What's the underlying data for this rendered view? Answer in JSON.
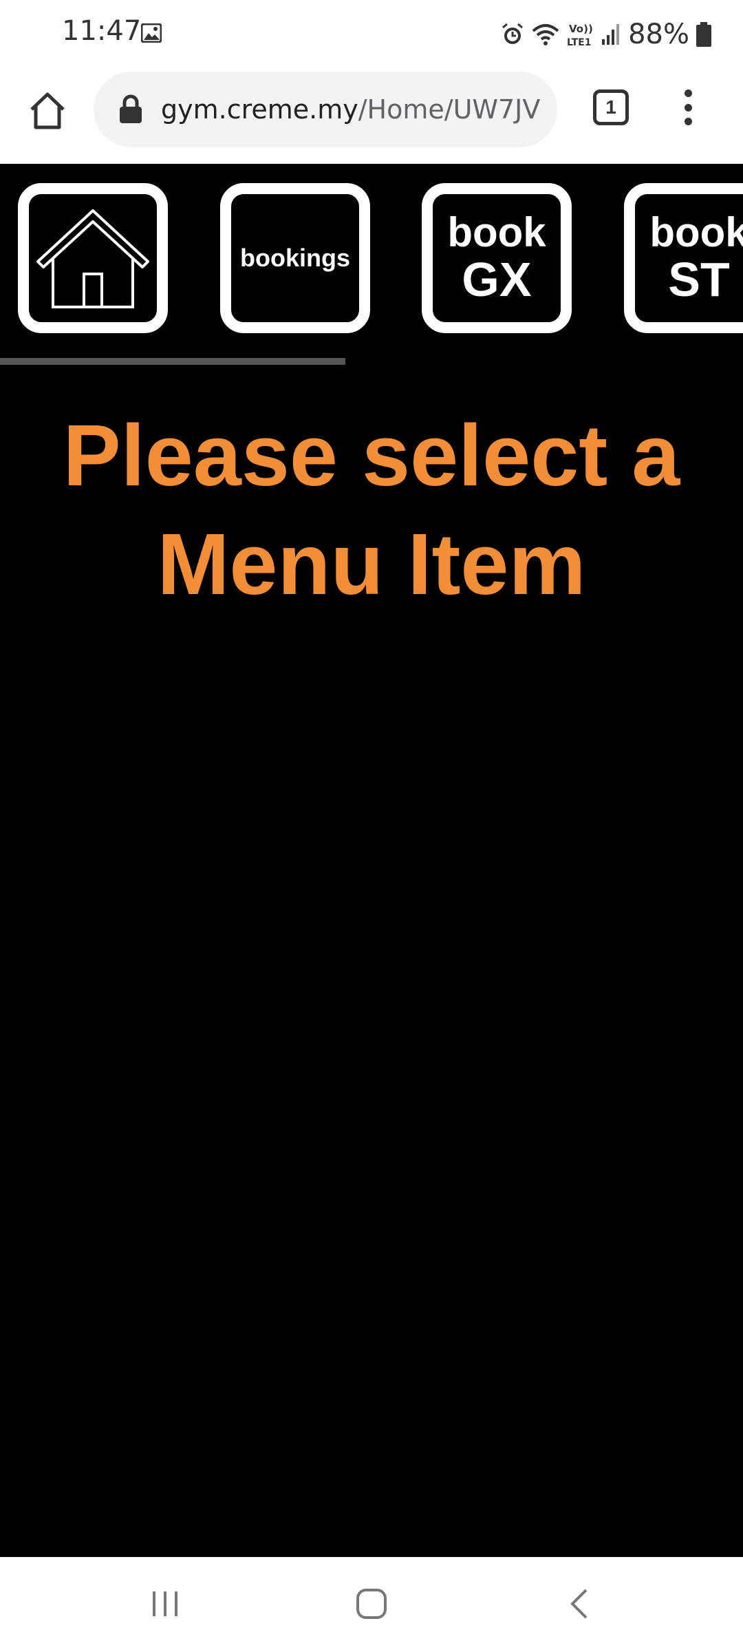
{
  "status_bar": {
    "time": "11:47",
    "battery_percent": "88%",
    "icons": [
      "gallery-icon",
      "alarm-icon",
      "wifi-icon",
      "volte-icon",
      "signal-icon",
      "battery-icon"
    ]
  },
  "browser": {
    "url_domain": "gym.creme.my",
    "url_path": "/Home/UW7JV",
    "tab_count": "1"
  },
  "nav_tiles": {
    "home": {
      "icon": "house-icon"
    },
    "bookings": {
      "label": "bookings"
    },
    "book_gx": {
      "line1": "book",
      "line2": "GX"
    },
    "book_st": {
      "line1": "book",
      "line2": "ST"
    }
  },
  "main": {
    "headline": "Please select a Menu Item",
    "accent_color": "#f18e37"
  },
  "system_nav": {
    "buttons": [
      "recents-icon",
      "home-icon",
      "back-icon"
    ]
  }
}
